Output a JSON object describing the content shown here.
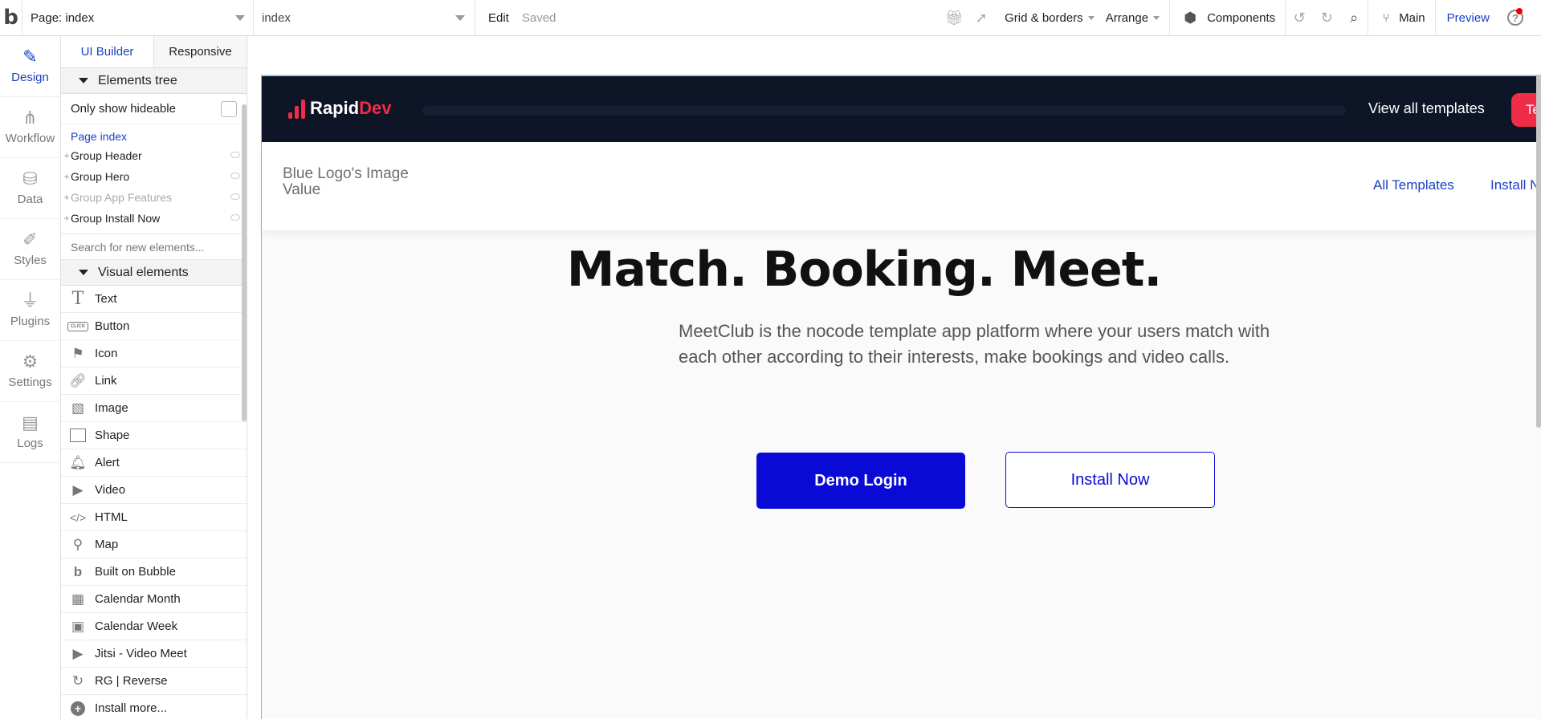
{
  "app": {
    "logo_glyph": "b"
  },
  "topbar": {
    "page_select": "Page: index",
    "page_name_select": "index",
    "edit_label": "Edit",
    "saved_label": "Saved",
    "grid_borders": "Grid & borders",
    "arrange": "Arrange",
    "components": "Components",
    "branch": "Main",
    "preview": "Preview",
    "help_glyph": "?"
  },
  "rail": {
    "items": [
      {
        "label": "Design",
        "icon": "pencil-ruler-icon",
        "glyph": "✎"
      },
      {
        "label": "Workflow",
        "icon": "workflow-icon",
        "glyph": "⋔"
      },
      {
        "label": "Data",
        "icon": "database-icon",
        "glyph": "⛁"
      },
      {
        "label": "Styles",
        "icon": "brush-icon",
        "glyph": "✐"
      },
      {
        "label": "Plugins",
        "icon": "plug-icon",
        "glyph": "⏚"
      },
      {
        "label": "Settings",
        "icon": "gear-icon",
        "glyph": "⚙"
      },
      {
        "label": "Logs",
        "icon": "document-icon",
        "glyph": "▤"
      }
    ]
  },
  "panel": {
    "tabs": [
      "UI Builder",
      "Responsive"
    ],
    "elements_tree_title": "Elements tree",
    "only_show_hideable": "Only show hideable",
    "tree_page": "Page index",
    "tree_items": [
      {
        "label": "Group Header",
        "muted": false
      },
      {
        "label": "Group Hero",
        "muted": false
      },
      {
        "label": "Group App Features",
        "muted": true
      },
      {
        "label": "Group Install Now",
        "muted": false
      }
    ],
    "search_placeholder": "Search for new elements...",
    "visual_elements_title": "Visual elements",
    "visual_elements": [
      {
        "label": "Text",
        "icon": "text-icon"
      },
      {
        "label": "Button",
        "icon": "button-icon"
      },
      {
        "label": "Icon",
        "icon": "flag-icon"
      },
      {
        "label": "Link",
        "icon": "link-icon"
      },
      {
        "label": "Image",
        "icon": "image-icon"
      },
      {
        "label": "Shape",
        "icon": "shape-icon"
      },
      {
        "label": "Alert",
        "icon": "bell-icon"
      },
      {
        "label": "Video",
        "icon": "video-icon"
      },
      {
        "label": "HTML",
        "icon": "code-icon"
      },
      {
        "label": "Map",
        "icon": "map-pin-icon"
      },
      {
        "label": "Built on Bubble",
        "icon": "bubble-logo-icon"
      },
      {
        "label": "Calendar Month",
        "icon": "calendar-icon"
      },
      {
        "label": "Calendar Week",
        "icon": "calendar-week-icon"
      },
      {
        "label": "Jitsi - Video Meet",
        "icon": "camera-icon"
      },
      {
        "label": "RG | Reverse",
        "icon": "reverse-icon"
      },
      {
        "label": "Install more...",
        "icon": "plus-circle-icon"
      }
    ],
    "button_icon_text": "CLICK"
  },
  "canvas": {
    "header": {
      "brand_part1": "Rapid",
      "brand_part2": "Dev",
      "view_all": "View all templates",
      "cta_partial": "Te"
    },
    "nav": {
      "logo_text": "Blue Logo's Image Value",
      "link_all": "All Templates",
      "link_install": "Install N"
    },
    "hero": {
      "title": "Match. Booking. Meet.",
      "description": "MeetClub is the nocode template app platform where your users match with each other according to their interests, make bookings and video calls.",
      "primary_button": "Demo Login",
      "secondary_button": "Install Now"
    }
  },
  "colors": {
    "accent_blue": "#1a3fc7",
    "primary_button": "#0a0ad6",
    "header_bg": "#0d1526",
    "brand_red": "#ef2d48"
  }
}
